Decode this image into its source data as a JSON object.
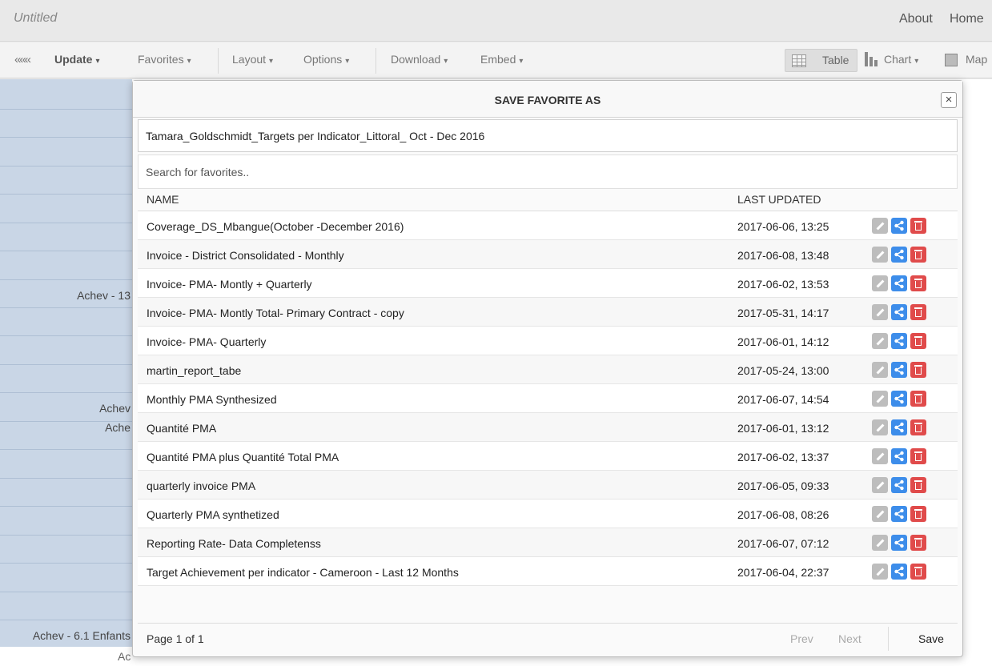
{
  "app": {
    "title": "Untitled",
    "about_link": "About",
    "home_link": "Home"
  },
  "toolbar": {
    "collapse_icon": "«««",
    "update_label": "Update",
    "favorites_label": "Favorites",
    "layout_label": "Layout",
    "options_label": "Options",
    "download_label": "Download",
    "embed_label": "Embed",
    "table_label": "Table",
    "chart_label": "Chart",
    "map_label": "Map"
  },
  "background": {
    "labels": [
      "Achev - 13",
      "Achev",
      "Ache",
      "Achev - 6.1 Enfants",
      "Ac"
    ],
    "bottom_text": "Ac"
  },
  "dialog": {
    "title": "SAVE FAVORITE AS",
    "name_value": "Tamara_Goldschmidt_Targets per Indicator_Littoral_ Oct - Dec 2016",
    "search_placeholder": "Search for favorites..",
    "col_name": "NAME",
    "col_updated": "LAST UPDATED",
    "rows": [
      {
        "name": "Coverage_DS_Mbangue(October -December 2016)",
        "updated": "2017-06-06, 13:25"
      },
      {
        "name": "Invoice - District Consolidated - Monthly",
        "updated": "2017-06-08, 13:48"
      },
      {
        "name": "Invoice- PMA- Montly + Quarterly",
        "updated": "2017-06-02, 13:53"
      },
      {
        "name": "Invoice- PMA- Montly Total- Primary Contract - copy",
        "updated": "2017-05-31, 14:17"
      },
      {
        "name": "Invoice- PMA- Quarterly",
        "updated": "2017-06-01, 14:12"
      },
      {
        "name": "martin_report_tabe",
        "updated": "2017-05-24, 13:00"
      },
      {
        "name": "Monthly PMA Synthesized",
        "updated": "2017-06-07, 14:54"
      },
      {
        "name": "Quantité PMA",
        "updated": "2017-06-01, 13:12"
      },
      {
        "name": "Quantité PMA plus Quantité Total PMA",
        "updated": "2017-06-02, 13:37"
      },
      {
        "name": "quarterly invoice PMA",
        "updated": "2017-06-05, 09:33"
      },
      {
        "name": "Quarterly PMA synthetized",
        "updated": "2017-06-08, 08:26"
      },
      {
        "name": "Reporting Rate- Data Completenss",
        "updated": "2017-06-07, 07:12"
      },
      {
        "name": "Target Achievement per indicator - Cameroon - Last 12 Months",
        "updated": "2017-06-04, 22:37"
      }
    ],
    "page_info": "Page 1 of 1",
    "prev_label": "Prev",
    "next_label": "Next",
    "save_label": "Save"
  },
  "colors": {
    "share_icon": "#3d8dea",
    "delete_icon": "#e04b4b",
    "edit_icon": "#bdbdbd",
    "sidebar_bg": "#c9d6e6"
  }
}
